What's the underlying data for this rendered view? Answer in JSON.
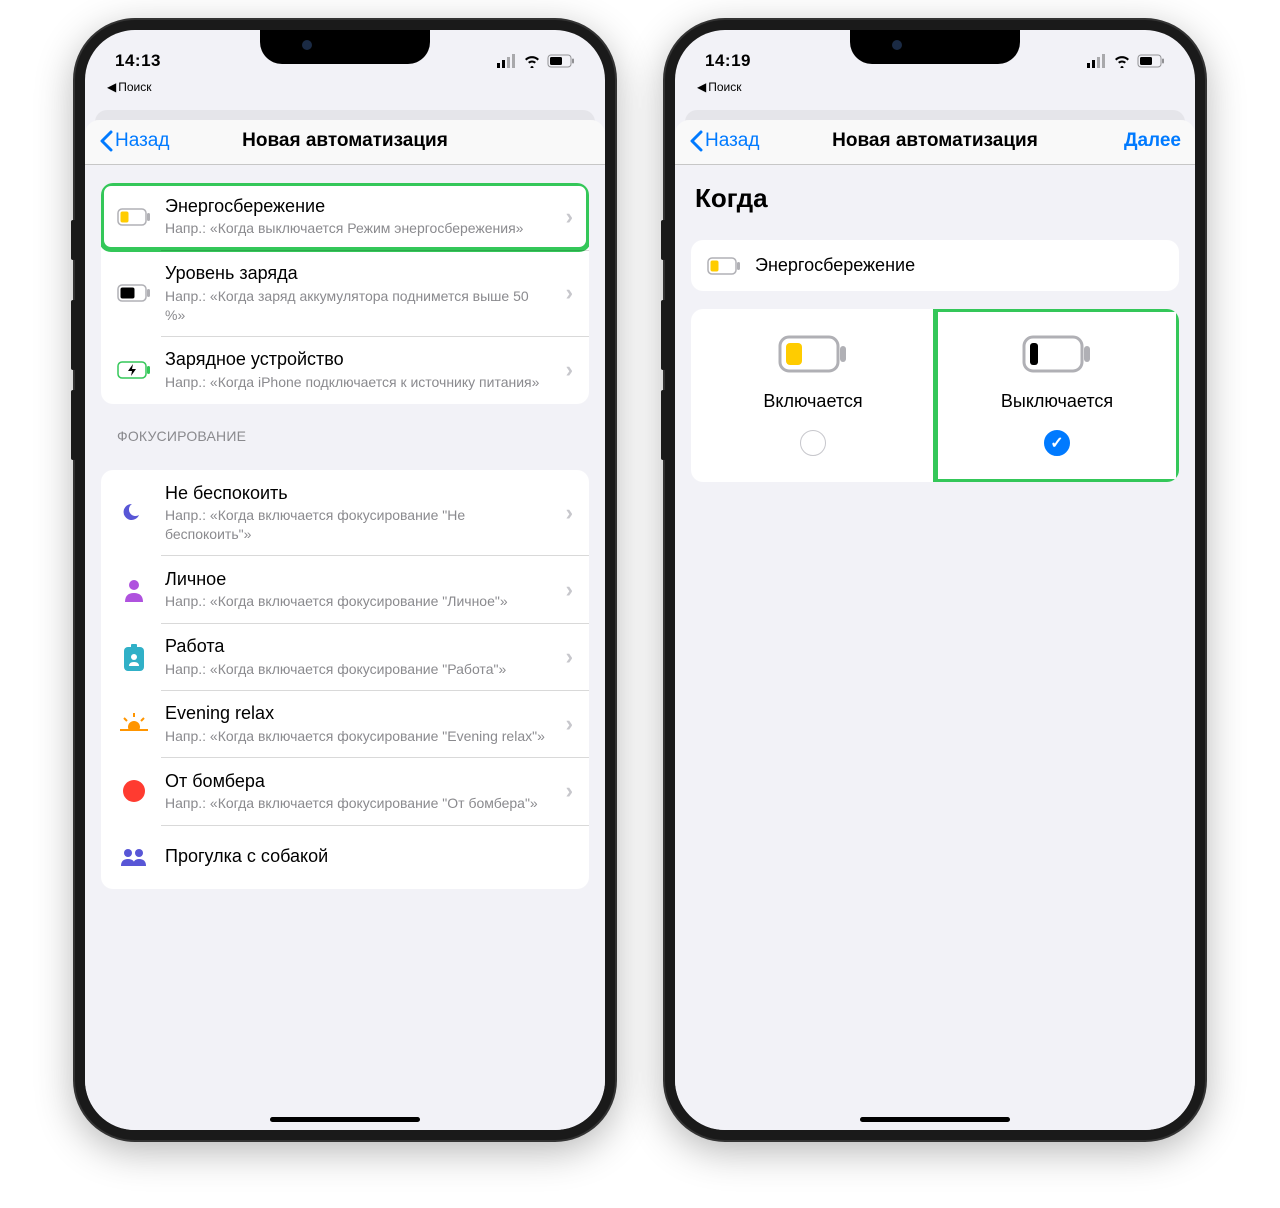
{
  "left": {
    "status": {
      "time": "14:13",
      "breadcrumb": "Поиск"
    },
    "nav": {
      "back": "Назад",
      "title": "Новая автоматизация"
    },
    "rows": [
      {
        "title": "Энергосбережение",
        "sub": "Напр.: «Когда выключается Режим энергосбережения»"
      },
      {
        "title": "Уровень заряда",
        "sub": "Напр.: «Когда заряд аккумулятора поднимется выше 50 %»"
      },
      {
        "title": "Зарядное устройство",
        "sub": "Напр.: «Когда iPhone подключается к источнику питания»"
      }
    ],
    "focus_header": "ФОКУСИРОВАНИЕ",
    "focus_rows": [
      {
        "title": "Не беспокоить",
        "sub": "Напр.: «Когда включается фокусирование \"Не беспокоить\"»"
      },
      {
        "title": "Личное",
        "sub": "Напр.: «Когда включается фокусирование \"Личное\"»"
      },
      {
        "title": "Работа",
        "sub": "Напр.: «Когда включается фокусирование \"Работа\"»"
      },
      {
        "title": "Evening relax",
        "sub": "Напр.: «Когда включается фокусирование \"Evening relax\"»"
      },
      {
        "title": "От бомбера",
        "sub": "Напр.: «Когда включается фокусирование \"От бомбера\"»"
      },
      {
        "title": "Прогулка с собакой",
        "sub": ""
      }
    ]
  },
  "right": {
    "status": {
      "time": "14:19",
      "breadcrumb": "Поиск"
    },
    "nav": {
      "back": "Назад",
      "title": "Новая автоматизация",
      "next": "Далее"
    },
    "page_title": "Когда",
    "pill_label": "Энергосбережение",
    "options": {
      "on": "Включается",
      "off": "Выключается"
    }
  }
}
